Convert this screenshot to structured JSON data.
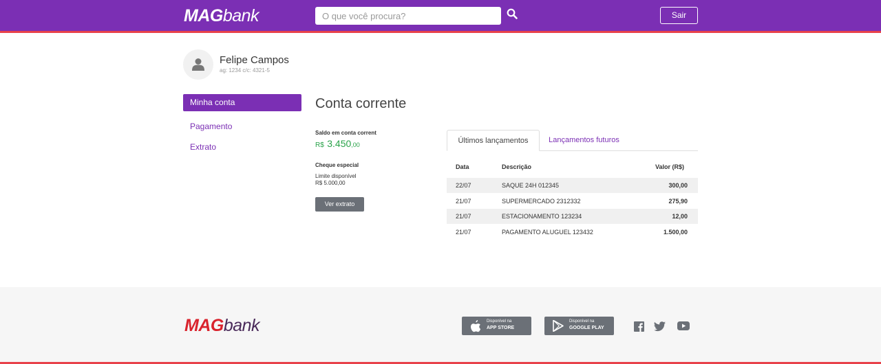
{
  "header": {
    "logo_bold": "MAG",
    "logo_light": "bank",
    "search_placeholder": "O que você procura?",
    "logout_label": "Sair"
  },
  "user": {
    "name": "Felipe Campos",
    "account": "ag: 1234 c/c: 4321-5"
  },
  "sidebar": {
    "items": [
      {
        "label": "Minha conta",
        "active": true
      },
      {
        "label": "Pagamento",
        "active": false
      },
      {
        "label": "Extrato",
        "active": false
      }
    ]
  },
  "main": {
    "title": "Conta corrente",
    "balance_label": "Saldo em conta corrent",
    "balance_currency": "R$",
    "balance_integer": "3.450",
    "balance_decimal": ",00",
    "cheque_label": "Cheque especial",
    "limit_label": "Limite disponível",
    "limit_value": "R$ 5.000,00",
    "extrato_button": "Ver extrato"
  },
  "tabs": [
    {
      "label": "Últimos lançamentos",
      "active": true
    },
    {
      "label": "Lançamentos futuros",
      "active": false
    }
  ],
  "table": {
    "headers": {
      "date": "Data",
      "description": "Descrição",
      "value": "Valor (R$)"
    },
    "rows": [
      {
        "date": "22/07",
        "description": "SAQUE 24H 012345",
        "value": "300,00"
      },
      {
        "date": "21/07",
        "description": "SUPERMERCADO 2312332",
        "value": "275,90"
      },
      {
        "date": "21/07",
        "description": "ESTACIONAMENTO 123234",
        "value": "12,00"
      },
      {
        "date": "21/07",
        "description": "PAGAMENTO ALUGUEL 123432",
        "value": "1.500,00"
      }
    ]
  },
  "footer": {
    "logo_bold": "MAG",
    "logo_light": "bank",
    "app_store": {
      "small": "Disponível na",
      "big": "APP STORE"
    },
    "google_play": {
      "small": "Disponível na",
      "big": "GOOGLE PLAY"
    },
    "social_icons": [
      "facebook-icon",
      "twitter-icon",
      "youtube-icon"
    ]
  },
  "colors": {
    "brand_purple": "#7b2fb4",
    "accent_red": "#e8424a",
    "balance_green": "#2aa34a",
    "button_gray": "#6b7077"
  }
}
